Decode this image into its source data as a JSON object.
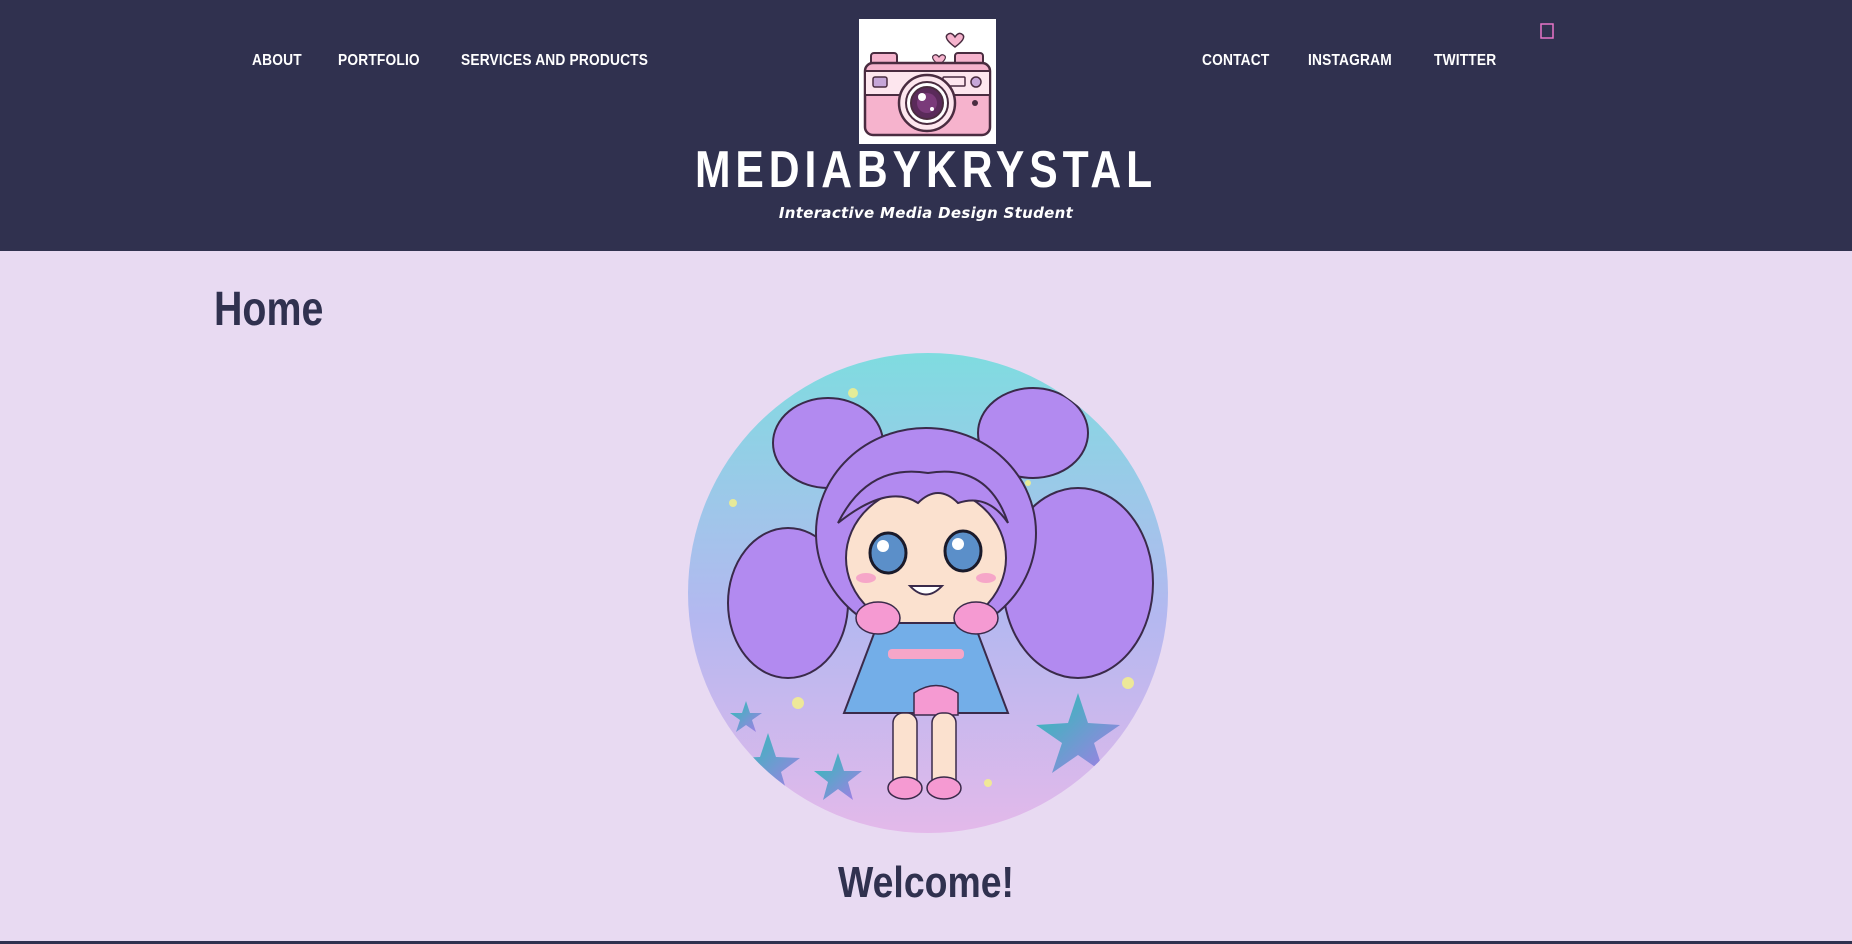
{
  "nav": {
    "left": [
      {
        "label": "ABOUT"
      },
      {
        "label": "PORTFOLIO"
      },
      {
        "label": "SERVICES AND PRODUCTS"
      }
    ],
    "right": [
      {
        "label": "CONTACT"
      },
      {
        "label": "INSTAGRAM"
      },
      {
        "label": "TWITTER"
      }
    ]
  },
  "site": {
    "title": "MEDIABYKRYSTAL",
    "tagline": "Interactive Media Design Student",
    "logo_icon": "camera-icon"
  },
  "cart": {
    "icon": "cart-icon"
  },
  "main": {
    "heading": "Home",
    "welcome": "Welcome!"
  },
  "colors": {
    "header_bg": "#30314f",
    "page_bg": "#e8daf2",
    "accent_pink": "#e874c8"
  }
}
